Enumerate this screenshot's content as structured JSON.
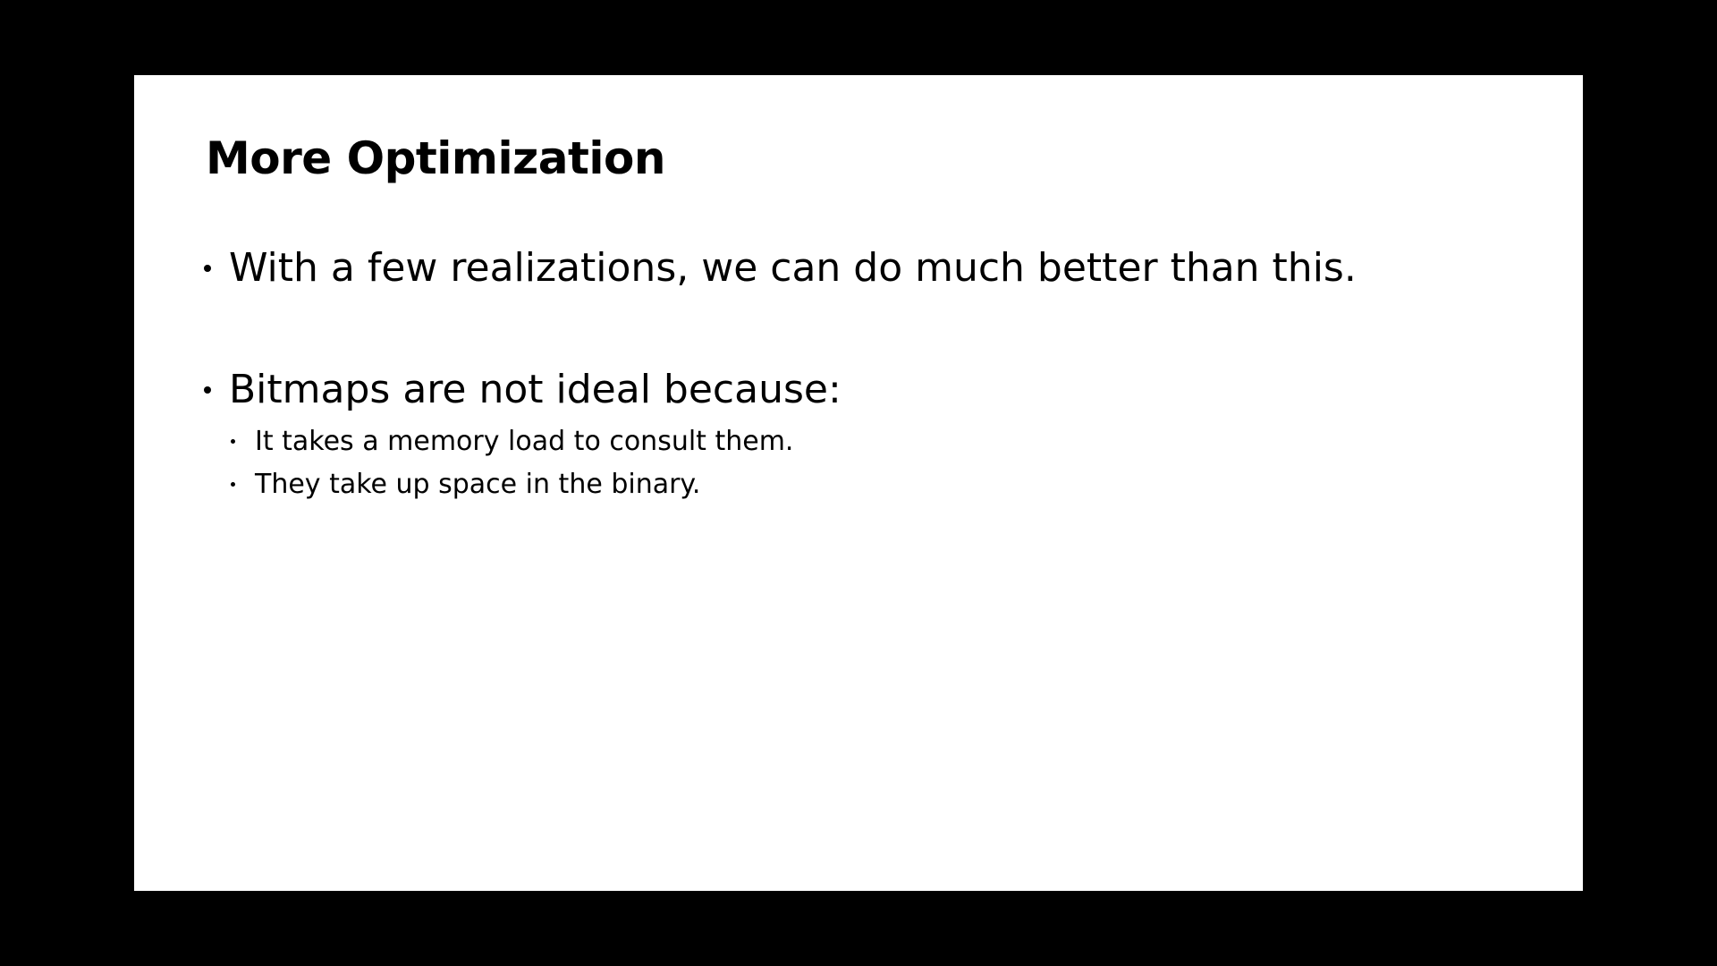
{
  "slide": {
    "title": "More Optimization",
    "bullets": [
      {
        "text": "With a few realizations, we can do much better than this.",
        "sub": []
      },
      {
        "text": "Bitmaps are not ideal because:",
        "sub": [
          "It takes a memory load to consult them.",
          "They take up space in the binary."
        ]
      }
    ]
  }
}
